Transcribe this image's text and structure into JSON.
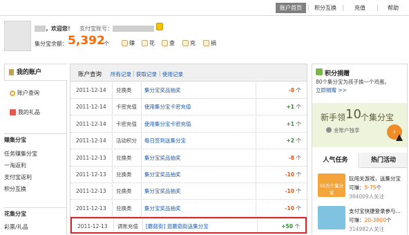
{
  "topnav": {
    "items": [
      {
        "label": "账户首页",
        "active": true
      },
      {
        "label": "积分互换",
        "active": false
      },
      {
        "label": "充值",
        "active": false
      },
      {
        "label": "帮助",
        "active": false
      }
    ]
  },
  "header": {
    "welcome": "，欢迎您！",
    "alipay_label": "支付宝账号：",
    "balance_label": "集分宝余额：",
    "balance_value": "5,392",
    "balance_unit": "个",
    "quick_actions": [
      "赚",
      "花",
      "查",
      "充",
      "捐"
    ]
  },
  "sidebar": {
    "title": "我的账户",
    "main_items": [
      "账户查询",
      "我的礼品"
    ],
    "earn_heading": "赚集分宝",
    "earn_items": [
      "任务赚集分宝",
      "一淘返利",
      "支付宝返利",
      "积分互换"
    ],
    "spend_heading": "花集分宝",
    "spend_items": [
      "彩票/礼品"
    ]
  },
  "main": {
    "title": "账户查询",
    "tabs": [
      "所有记录",
      "获取记录",
      "使用记录"
    ],
    "rows": [
      {
        "date": "2011-12-14",
        "type": "兑换类",
        "desc": "集分宝奖品抽奖",
        "amount": "-8",
        "unit": "个",
        "sign": "minus",
        "highlight": false
      },
      {
        "date": "2011-12-14",
        "type": "卡密充值",
        "desc": "使用集分宝卡密充值",
        "amount": "+1",
        "unit": "个",
        "sign": "plus",
        "highlight": false
      },
      {
        "date": "2011-12-14",
        "type": "卡密充值",
        "desc": "使用集分宝卡密充值",
        "amount": "+1",
        "unit": "个",
        "sign": "plus",
        "highlight": false
      },
      {
        "date": "2011-12-14",
        "type": "活动积分",
        "desc": "每日签到送集分宝",
        "amount": "+2",
        "unit": "个",
        "sign": "plus",
        "highlight": false
      },
      {
        "date": "2011-12-13",
        "type": "兑换类",
        "desc": "集分宝奖品抽奖",
        "amount": "-8",
        "unit": "个",
        "sign": "minus",
        "highlight": false
      },
      {
        "date": "2011-12-13",
        "type": "兑换类",
        "desc": "集分宝奖品抽奖",
        "amount": "-10",
        "unit": "个",
        "sign": "minus",
        "highlight": false
      },
      {
        "date": "2011-12-13",
        "type": "兑换类",
        "desc": "集分宝奖品抽奖",
        "amount": "-10",
        "unit": "个",
        "sign": "minus",
        "highlight": false
      },
      {
        "date": "2011-12-13",
        "type": "兑换类",
        "desc": "集分宝奖品抽奖",
        "amount": "-10",
        "unit": "个",
        "sign": "minus",
        "highlight": false
      },
      {
        "date": "2011-12-13",
        "type": "调账充值",
        "desc": "[蘑菇街] 逛蘑菇街送集分宝",
        "amount": "+50",
        "unit": "个",
        "sign": "plus",
        "highlight": true
      }
    ]
  },
  "right": {
    "donate_title": "积分捐赠",
    "donate_desc": "80个集分宝为孩子换一个鸡蛋。",
    "donate_link": "立即捐赠 >>",
    "banner_text_a": "新手领",
    "banner_num": "10",
    "banner_text_b": "个集分宝",
    "banner_sub": "金账户独享",
    "tabs": [
      "人气任务",
      "热门活动"
    ],
    "tasks": [
      {
        "title": "玩闯关游戏，送集分宝",
        "earn_label": "可赚：",
        "earn_value": "5-75",
        "earn_unit": "个",
        "followers": "384009人关注",
        "thumb": "50万个集分宝"
      },
      {
        "title": "支付宝快捷登录参与…",
        "earn_label": "可赚：",
        "earn_value": "20-3800",
        "earn_unit": "个",
        "followers": "314982人关注",
        "thumb": ""
      }
    ]
  },
  "colors": {
    "balance": "#ff6600",
    "plus": "#2e8b2e",
    "minus": "#e55a1a",
    "link": "#1d58a8",
    "highlight_border": "#d9232a"
  }
}
